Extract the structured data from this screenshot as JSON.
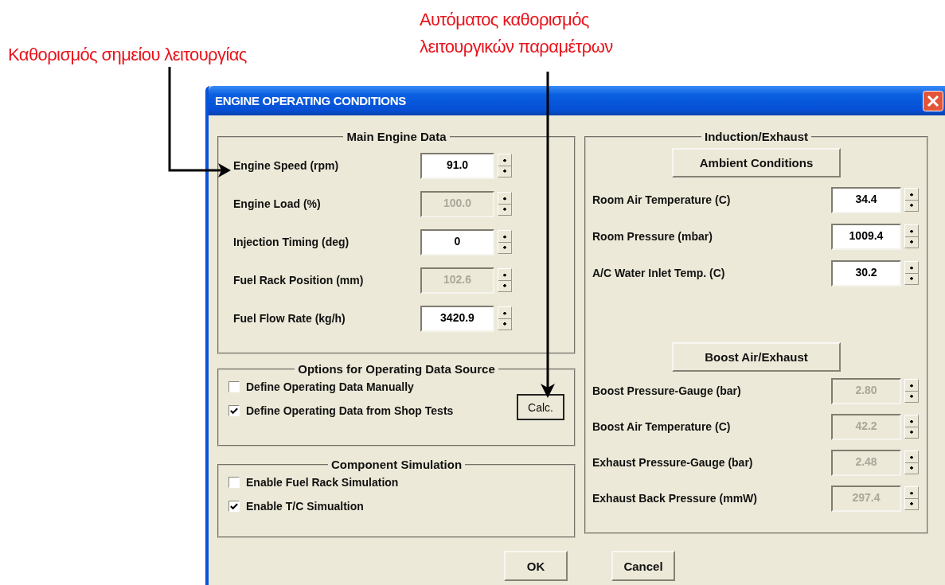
{
  "annotations": [
    {
      "lines": [
        "Καθορισμός  σημείου λειτουργίας"
      ]
    },
    {
      "lines": [
        "Αυτόματος καθορισμός",
        "λειτουργικών παραμέτρων"
      ]
    }
  ],
  "window": {
    "title": "ENGINE OPERATING CONDITIONS"
  },
  "main_engine_data": {
    "title": "Main Engine Data",
    "fields": [
      {
        "label": "Engine Speed (rpm)",
        "value": "91.0",
        "disabled": false
      },
      {
        "label": "Engine Load (%)",
        "value": "100.0",
        "disabled": true
      },
      {
        "label": "Injection Timing (deg)",
        "value": "0",
        "disabled": false
      },
      {
        "label": "Fuel Rack Position (mm)",
        "value": "102.6",
        "disabled": true
      },
      {
        "label": "Fuel Flow Rate (kg/h)",
        "value": "3420.9",
        "disabled": false
      }
    ]
  },
  "options": {
    "title": "Options for Operating Data Source",
    "checkboxes": [
      {
        "label": "Define Operating Data Manually",
        "checked": false
      },
      {
        "label": "Define Operating Data from Shop Tests",
        "checked": true
      }
    ],
    "calc_button": "Calc."
  },
  "component_simulation": {
    "title": "Component Simulation",
    "checkboxes": [
      {
        "label": "Enable Fuel Rack Simulation",
        "checked": false
      },
      {
        "label": "Enable T/C Simualtion",
        "checked": true
      }
    ]
  },
  "induction_exhaust": {
    "title": "Induction/Exhaust",
    "sections": [
      {
        "button": "Ambient Conditions",
        "fields": [
          {
            "label": "Room Air Temperature (C)",
            "value": "34.4",
            "disabled": false
          },
          {
            "label": "Room Pressure (mbar)",
            "value": "1009.4",
            "disabled": false
          },
          {
            "label": "A/C  Water Inlet Temp. (C)",
            "value": "30.2",
            "disabled": false
          }
        ]
      },
      {
        "button": "Boost Air/Exhaust",
        "fields": [
          {
            "label": "Boost Pressure-Gauge (bar)",
            "value": "2.80",
            "disabled": true
          },
          {
            "label": "Boost Air Temperature (C)",
            "value": "42.2",
            "disabled": true
          },
          {
            "label": "Exhaust Pressure-Gauge (bar)",
            "value": "2.48",
            "disabled": true
          },
          {
            "label": "Exhaust Back Pressure (mmW)",
            "value": "297.4",
            "disabled": true
          }
        ]
      }
    ]
  },
  "buttons": [
    "OK",
    "Cancel"
  ]
}
